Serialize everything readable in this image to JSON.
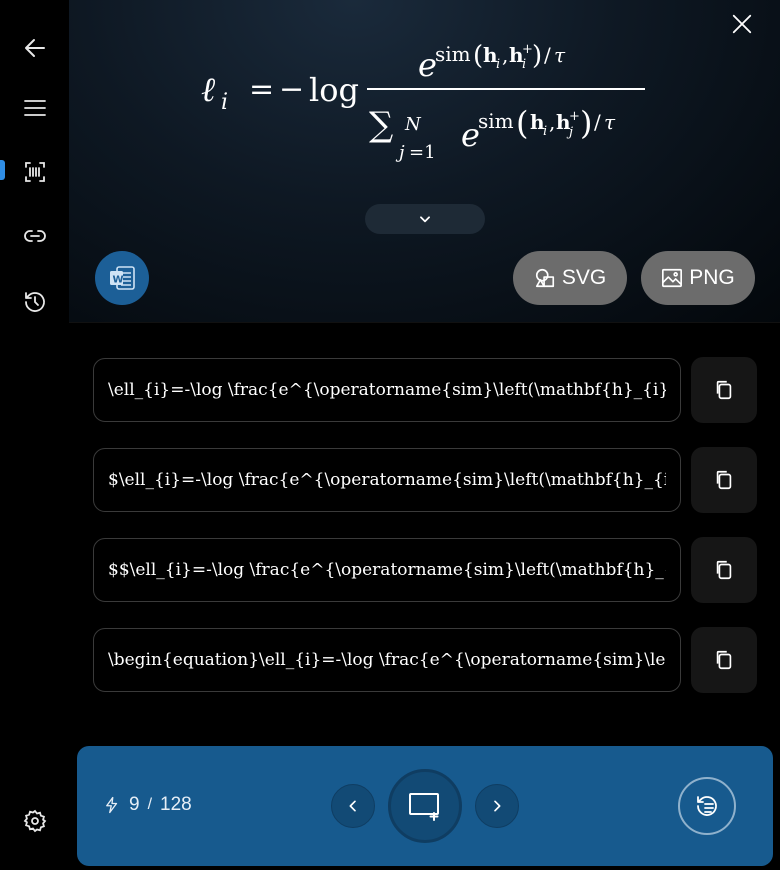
{
  "sidebar": {
    "items": [
      {
        "name": "back",
        "icon": "back-arrow-icon"
      },
      {
        "name": "menu",
        "icon": "hamburger-icon"
      },
      {
        "name": "scan",
        "icon": "scan-barcode-icon",
        "active": true
      },
      {
        "name": "link",
        "icon": "link-icon"
      },
      {
        "name": "history",
        "icon": "history-icon"
      }
    ],
    "settings_icon": "gear-icon"
  },
  "preview": {
    "formula_latex": "\\ell_{i}=-\\log \\frac{e^{\\operatorname{sim}\\left(\\mathbf{h}_{i},\\mathbf{h}_{i}^{+}\\right)/\\tau}}{\\sum_{j=1}^{N} e^{\\operatorname{sim}\\left(\\mathbf{h}_{i},\\mathbf{h}_{j}^{+}\\right)/\\tau}}"
  },
  "export": {
    "svg_label": "SVG",
    "png_label": "PNG"
  },
  "code_rows": [
    {
      "text": "\\ell_{i}=-\\log \\frac{e^{\\operatorname{sim}\\left(\\mathbf{h}_{i},"
    },
    {
      "text": "$\\ell_{i}=-\\log \\frac{e^{\\operatorname{sim}\\left(\\mathbf{h}_{i}"
    },
    {
      "text": "$$\\ell_{i}=-\\log \\frac{e^{\\operatorname{sim}\\left(\\mathbf{h}_{"
    },
    {
      "text": "\\begin{equation}\\ell_{i}=-\\log \\frac{e^{\\operatorname{sim}\\lef"
    }
  ],
  "bottom": {
    "quota_used": "9",
    "quota_sep": "/",
    "quota_total": "128"
  },
  "colors": {
    "accent": "#175a8e",
    "word_button": "#1c5f97",
    "export_button": "#6c6c6c"
  }
}
